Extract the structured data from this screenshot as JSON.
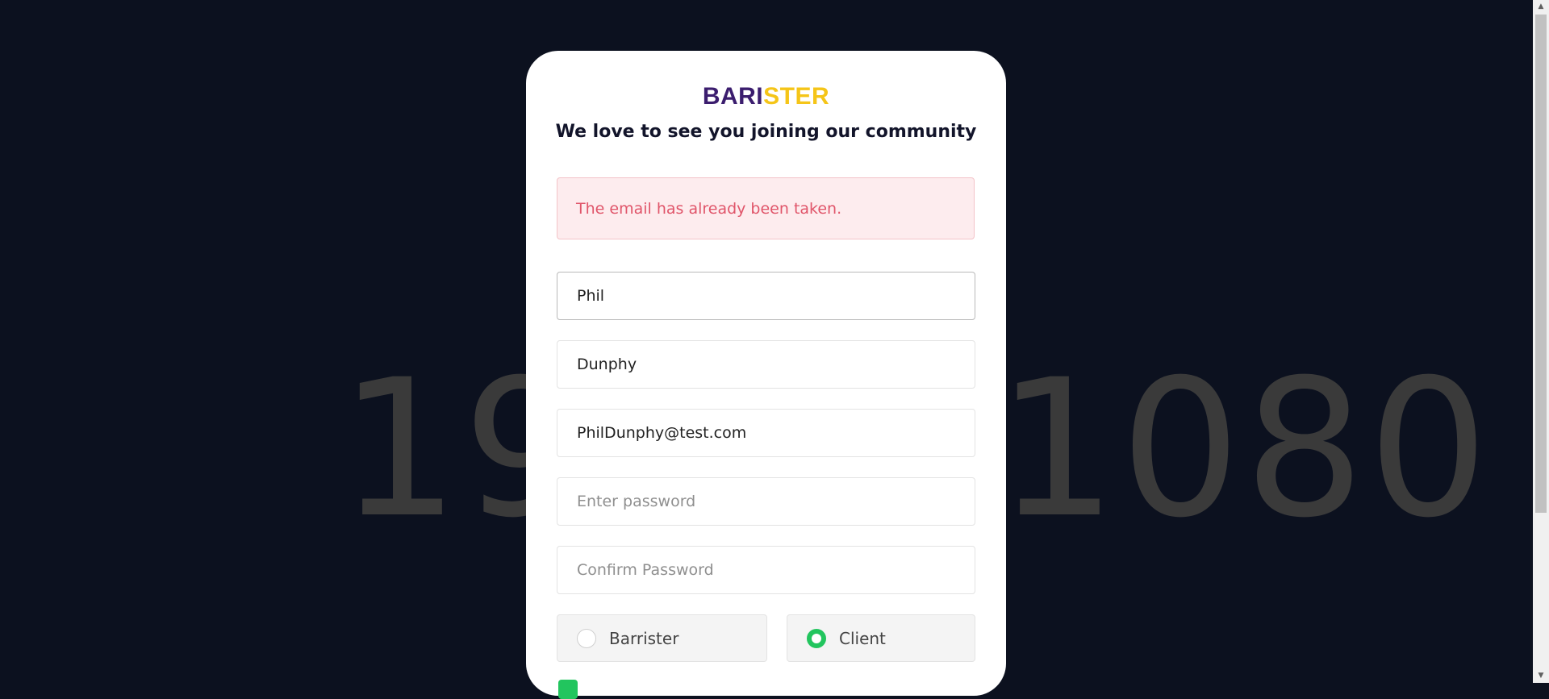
{
  "background": {
    "watermark_text": "1920×1080"
  },
  "logo": {
    "part1": "BARI",
    "part2": "STER"
  },
  "subtitle": "We love to see you joining our community",
  "alert": {
    "message": "The email has already been taken."
  },
  "form": {
    "first_name": {
      "value": "Phil",
      "placeholder": ""
    },
    "last_name": {
      "value": "Dunphy",
      "placeholder": ""
    },
    "email": {
      "value": "PhilDunphy@test.com",
      "placeholder": ""
    },
    "password": {
      "value": "",
      "placeholder": "Enter password"
    },
    "confirm_password": {
      "value": "",
      "placeholder": "Confirm Password"
    },
    "account_type": {
      "options": [
        {
          "label": "Barrister",
          "selected": false
        },
        {
          "label": "Client",
          "selected": true
        }
      ]
    }
  },
  "colors": {
    "page_background": "#0c111f",
    "logo_primary": "#3b1d6e",
    "logo_accent": "#f5c518",
    "alert_text": "#e0556a",
    "alert_background": "#fdecee",
    "radio_selected": "#22c55e"
  },
  "icons": {
    "scroll_up": "triangle-up-icon",
    "scroll_down": "triangle-down-icon"
  }
}
